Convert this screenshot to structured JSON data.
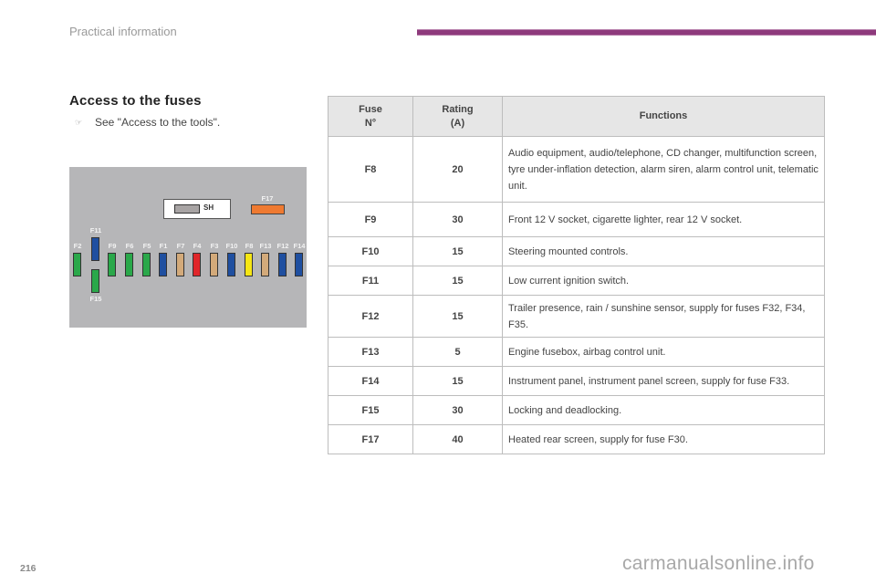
{
  "header": {
    "title": "Practical information",
    "accent_color": "#8e3a7c"
  },
  "section": {
    "title": "Access to the fuses",
    "bullet_icon": "pointing-hand-icon",
    "bullet_text": "See \"Access to the tools\"."
  },
  "diagram": {
    "sh_label": "SH",
    "f17_label": "F17",
    "fuses": [
      {
        "label": "F2",
        "color": "#2aa84a"
      },
      {
        "label": "F11",
        "color": "#1f4fa0"
      },
      {
        "label": "F15",
        "color": "#2aa84a"
      },
      {
        "label": "F9",
        "color": "#2aa84a"
      },
      {
        "label": "F6",
        "color": "#2aa84a"
      },
      {
        "label": "F5",
        "color": "#2aa84a"
      },
      {
        "label": "F1",
        "color": "#1f4fa0"
      },
      {
        "label": "F7",
        "color": "#d3aa7a"
      },
      {
        "label": "F4",
        "color": "#e0262a"
      },
      {
        "label": "F3",
        "color": "#d3aa7a"
      },
      {
        "label": "F10",
        "color": "#1f4fa0"
      },
      {
        "label": "F8",
        "color": "#f6e614"
      },
      {
        "label": "F13",
        "color": "#d3aa7a"
      },
      {
        "label": "F12",
        "color": "#1f4fa0"
      },
      {
        "label": "F14",
        "color": "#1f4fa0"
      }
    ],
    "f17_color": "#ef7a31"
  },
  "table": {
    "headers": [
      "Fuse\nN°",
      "Rating\n(A)",
      "Functions"
    ],
    "rows": [
      {
        "fuse": "F8",
        "rating": "20",
        "functions": "Audio equipment, audio/telephone, CD changer, multifunction screen, tyre under-inflation detection, alarm siren, alarm control unit, telematic unit."
      },
      {
        "fuse": "F9",
        "rating": "30",
        "functions": "Front 12 V socket, cigarette lighter, rear 12 V socket."
      },
      {
        "fuse": "F10",
        "rating": "15",
        "functions": "Steering mounted controls."
      },
      {
        "fuse": "F11",
        "rating": "15",
        "functions": "Low current ignition switch."
      },
      {
        "fuse": "F12",
        "rating": "15",
        "functions": "Trailer presence, rain / sunshine sensor, supply for fuses F32, F34, F35."
      },
      {
        "fuse": "F13",
        "rating": "5",
        "functions": "Engine fusebox, airbag control unit."
      },
      {
        "fuse": "F14",
        "rating": "15",
        "functions": "Instrument panel, instrument panel screen, supply for fuse F33."
      },
      {
        "fuse": "F15",
        "rating": "30",
        "functions": "Locking and deadlocking."
      },
      {
        "fuse": "F17",
        "rating": "40",
        "functions": "Heated rear screen, supply for fuse F30."
      }
    ]
  },
  "footer": {
    "page_number": "216",
    "watermark": "carmanualsonline.info"
  }
}
